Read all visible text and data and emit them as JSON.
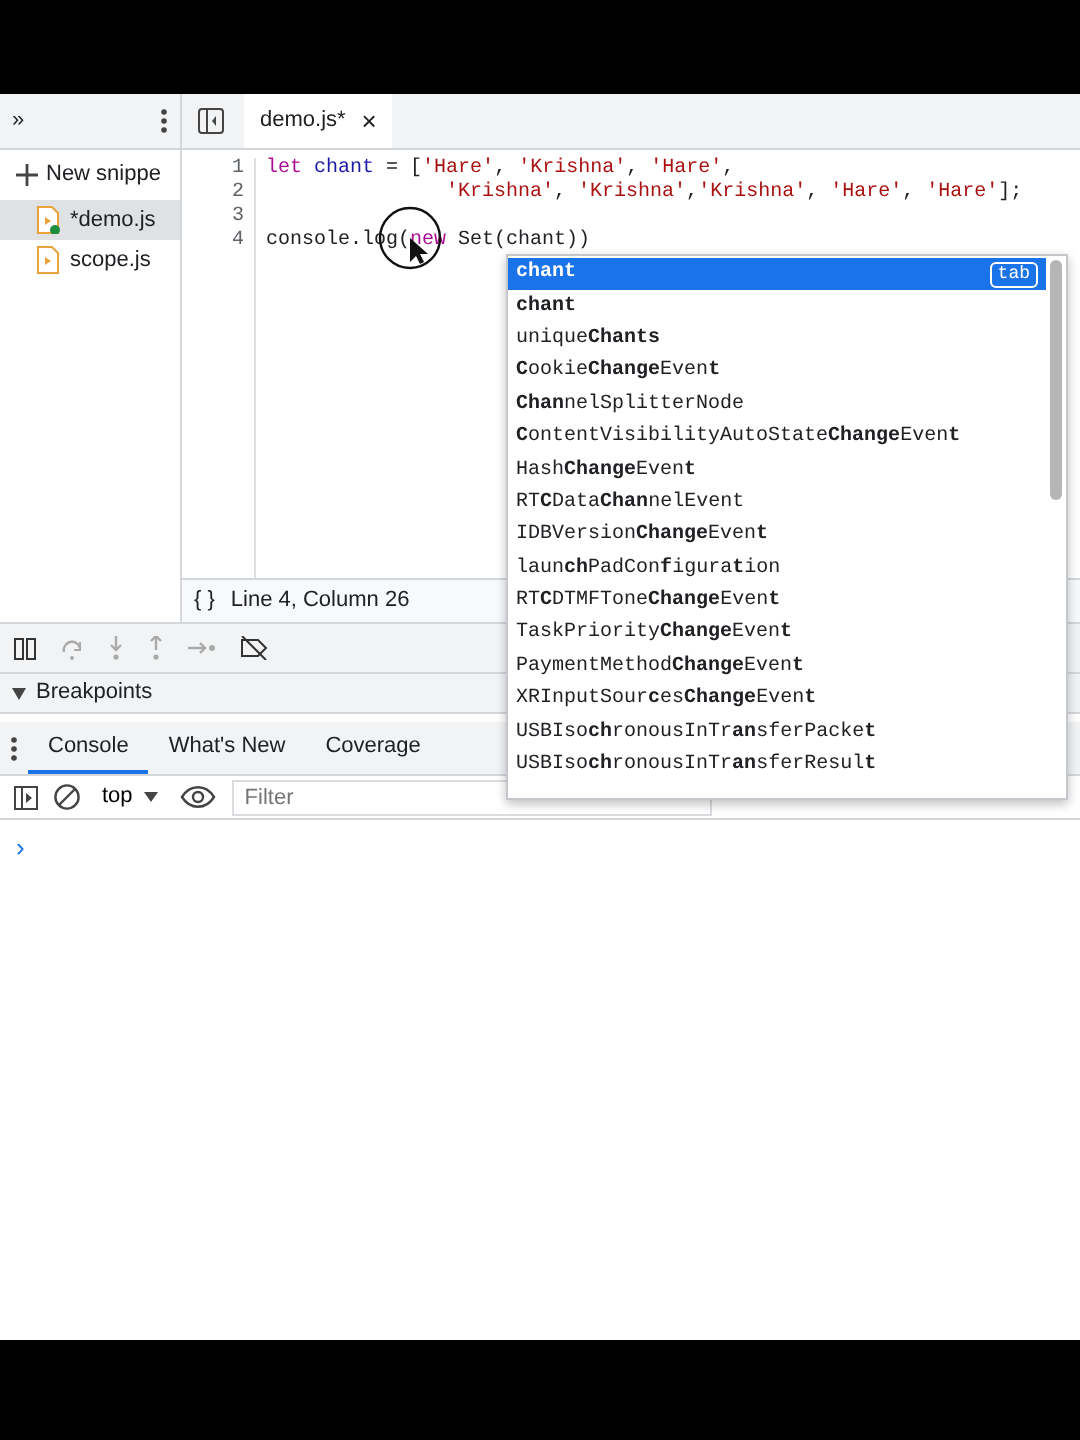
{
  "sidebar": {
    "more": "»",
    "new_snippet": "New snippe",
    "files": [
      {
        "name": "*demo.js",
        "selected": true,
        "modified": true
      },
      {
        "name": "scope.js",
        "selected": false,
        "modified": false
      }
    ]
  },
  "editor_tabs": [
    {
      "label": "demo.js*",
      "selected": true,
      "close": "×"
    }
  ],
  "code": [
    {
      "number": "1",
      "continuation": false,
      "tokens": [
        {
          "kind": "keyword",
          "text": "let"
        },
        {
          "kind": "variable",
          "text": " chant"
        },
        {
          "kind": "plain",
          "text": " = ["
        },
        {
          "kind": "string",
          "text": "'Hare'"
        },
        {
          "kind": "plain",
          "text": ", "
        },
        {
          "kind": "string",
          "text": "'Krishna'"
        },
        {
          "kind": "plain",
          "text": ", "
        },
        {
          "kind": "string",
          "text": "'Hare'"
        },
        {
          "kind": "plain",
          "text": ","
        }
      ]
    },
    {
      "number": "2",
      "continuation": true,
      "tokens": [
        {
          "kind": "string",
          "text": "'Krishna'"
        },
        {
          "kind": "plain",
          "text": ", "
        },
        {
          "kind": "string",
          "text": "'Krishna'"
        },
        {
          "kind": "plain",
          "text": ","
        },
        {
          "kind": "string",
          "text": "'Krishna'"
        },
        {
          "kind": "plain",
          "text": ", "
        },
        {
          "kind": "string",
          "text": "'Hare'"
        },
        {
          "kind": "plain",
          "text": ", "
        },
        {
          "kind": "string",
          "text": "'Hare'"
        },
        {
          "kind": "plain",
          "text": "];"
        }
      ]
    },
    {
      "number": "3",
      "continuation": false
    },
    {
      "number": "4",
      "continuation": false,
      "tokens": [
        {
          "kind": "plain",
          "text": "console.log("
        },
        {
          "kind": "keyword",
          "text": "new"
        },
        {
          "kind": "plain",
          "text": " Set(chant))"
        }
      ]
    }
  ],
  "status": {
    "braces": "{ }",
    "position": "Line 4, Column 26"
  },
  "autocomplete": {
    "hint": "tab",
    "items": [
      {
        "text": "**chant**",
        "selected": true
      },
      {
        "text": "**chant**",
        "selected": false
      },
      {
        "text": "unique**Chants**",
        "selected": false
      },
      {
        "text": "**C**ookie**Change**Even**t**",
        "selected": false
      },
      {
        "text": "**Chan**nelSplitterNode",
        "selected": false
      },
      {
        "text": "**C**ontentVisibilityAutoState**Change**Even**t**",
        "selected": false
      },
      {
        "text": "Hash**Change**Even**t**",
        "selected": false
      },
      {
        "text": "RT**C**Data**Chan**nelEvent",
        "selected": false
      },
      {
        "text": "IDBVersion**Change**Even**t**",
        "selected": false
      },
      {
        "text": "laun**ch**PadCon**f**igura**t**ion",
        "selected": false
      },
      {
        "text": "RT**C**DTMFTone**Change**Even**t**",
        "selected": false
      },
      {
        "text": "TaskPriority**Change**Even**t**",
        "selected": false
      },
      {
        "text": "PaymentMethod**Change**Even**t**",
        "selected": false
      },
      {
        "text": "XRInputSour**c**es**Change**Even**t**",
        "selected": false
      },
      {
        "text": "USBIso**ch**ronousInTr**an**sferPacke**t**",
        "selected": false
      },
      {
        "text": "USBIso**ch**ronousInTr**an**sferResul**t**",
        "selected": false
      }
    ]
  },
  "breakpoints": {
    "label": "Breakpoints",
    "expanded": true
  },
  "drawer_tabs": [
    {
      "label": "Console",
      "selected": true
    },
    {
      "label": "What's New",
      "selected": false
    },
    {
      "label": "Coverage",
      "selected": false
    }
  ],
  "console": {
    "context": "top",
    "filter_placeholder": "Filter",
    "prompt": "›"
  }
}
